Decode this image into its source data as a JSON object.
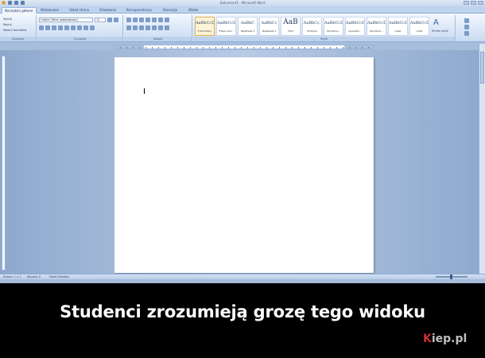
{
  "window": {
    "title": "Dokument1 - Microsoft Word"
  },
  "tabs": [
    {
      "label": "Narzędzia główne",
      "active": true
    },
    {
      "label": "Wstawianie"
    },
    {
      "label": "Układ strony"
    },
    {
      "label": "Odwołania"
    },
    {
      "label": "Korespondencja"
    },
    {
      "label": "Recenzja"
    },
    {
      "label": "Widok"
    }
  ],
  "ribbon": {
    "clipboard": {
      "label": "Schowek",
      "items": [
        "Wytnij",
        "Kopiuj",
        "Malarz formatów"
      ]
    },
    "font": {
      "label": "Czcionka",
      "font_name": "Calibri (Tekst podstawowy)",
      "font_size": "11"
    },
    "paragraph": {
      "label": "Akapit"
    },
    "styles": {
      "label": "Style",
      "tiles": [
        {
          "sample": "AaBbCcDc",
          "name": "¶ Normalny",
          "selected": true
        },
        {
          "sample": "AaBbCcDc",
          "name": "¶ Bez odst..."
        },
        {
          "sample": "AaBbC",
          "name": "Nagłówek 1"
        },
        {
          "sample": "AaBbCc",
          "name": "Nagłówek 2"
        },
        {
          "sample": "AaB",
          "name": "Tytuł",
          "big": true
        },
        {
          "sample": "AaBbCc.",
          "name": "Podtytuł"
        },
        {
          "sample": "AaBbCcDc",
          "name": "Wyróżnie..."
        },
        {
          "sample": "AaBbCcDc",
          "name": "Uwydatni..."
        },
        {
          "sample": "AaBbCcDc",
          "name": "Wyróżnie..."
        },
        {
          "sample": "AaBbCcDc",
          "name": "Cytat"
        },
        {
          "sample": "AaBbCcDc",
          "name": "Cytat"
        }
      ],
      "change_label": "Zmień style"
    }
  },
  "status": {
    "page": "Strona: 1 z 1",
    "words": "Wyrazy: 0",
    "language": "Polski (Polska)"
  },
  "caption": "Studenci zrozumieją grozę tego widoku",
  "logo": {
    "prefix": "",
    "accent": "K",
    "rest": "iep.pl"
  },
  "colors": {
    "background": "#000000",
    "workspace": "#a7bddc",
    "caption": "#ffffff",
    "logo_accent": "#c9302c"
  }
}
